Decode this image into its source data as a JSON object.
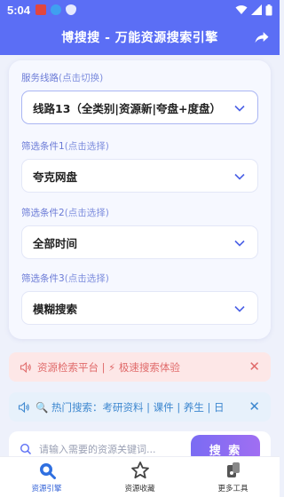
{
  "status": {
    "time": "5:04"
  },
  "app": {
    "title": "博搜搜 - 万能资源搜索引擎"
  },
  "filters": [
    {
      "label": "服务线路",
      "hint": "(点击切换)",
      "value": "线路13（全类别|资源新|夸盘+度盘）"
    },
    {
      "label": "筛选条件1",
      "hint": "(点击选择)",
      "value": "夸克网盘"
    },
    {
      "label": "筛选条件2",
      "hint": "(点击选择)",
      "value": "全部时间"
    },
    {
      "label": "筛选条件3",
      "hint": "(点击选择)",
      "value": "模糊搜索"
    }
  ],
  "notices": {
    "promo": "资源检索平台 | ⚡ 极速搜索体验",
    "hot": "🔍 热门搜索：考研资料 | 课件 | 养生 | 日"
  },
  "search": {
    "placeholder": "请输入需要的资源关键词...",
    "button": "搜 索"
  },
  "tabs": [
    {
      "label": "资源引擎",
      "icon": "search-engine-icon"
    },
    {
      "label": "资源收藏",
      "icon": "star-icon"
    },
    {
      "label": "更多工具",
      "icon": "tools-icon"
    }
  ],
  "colors": {
    "primary": "#5b6ef5",
    "accent": "#8f6df3",
    "promo_bg": "#fde7e7",
    "hot_bg": "#e7f1fb"
  }
}
